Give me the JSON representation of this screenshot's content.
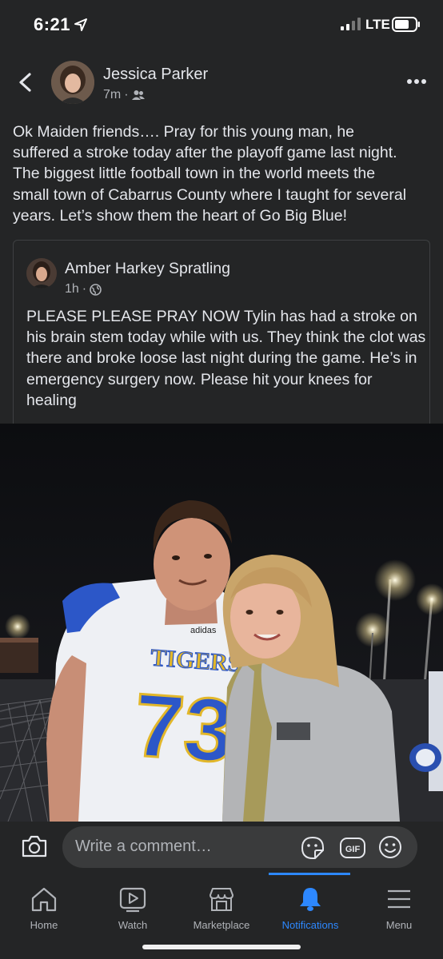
{
  "status": {
    "time": "6:21",
    "network": "LTE"
  },
  "post": {
    "author": "Jessica Parker",
    "time": "7m",
    "text": "Ok Maiden friends…. Pray for this young man, he\nsuffered a stroke today after the playoff game last night.\nThe biggest little football town in the world meets the\nsmall town of Cabarrus County where I taught for several\nyears.  Let’s show them the heart of Go Big Blue!"
  },
  "shared": {
    "author": "Amber Harkey Spratling",
    "time": "1h",
    "text": "PLEASE PLEASE PRAY NOW Tylin has had a stroke on his brain stem today while with us. They think the clot was there and broke loose last night during the game. He’s in emergency surgery now. Please hit your knees for healing"
  },
  "photo": {
    "jersey_word": "TIGERS",
    "jersey_number": "73",
    "brand": "adidas"
  },
  "comment": {
    "placeholder": "Write a comment…"
  },
  "tabs": [
    {
      "label": "Home",
      "icon": "home-icon"
    },
    {
      "label": "Watch",
      "icon": "watch-icon"
    },
    {
      "label": "Marketplace",
      "icon": "marketplace-icon"
    },
    {
      "label": "Notifications",
      "icon": "bell-icon",
      "active": true
    },
    {
      "label": "Menu",
      "icon": "menu-icon"
    }
  ],
  "colors": {
    "background": "#242526",
    "text": "#e4e6eb",
    "secondary": "#b0b3b8",
    "accent": "#2d88ff"
  }
}
